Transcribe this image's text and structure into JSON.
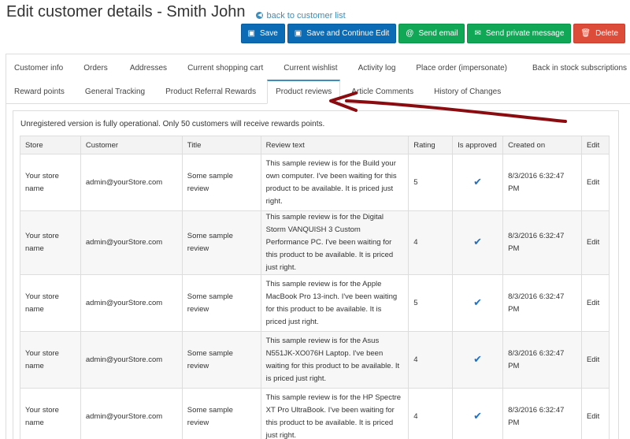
{
  "header": {
    "title": "Edit customer details - Smith John",
    "back_label": "back to customer list"
  },
  "actions": {
    "save": "Save",
    "save_continue": "Save and Continue Edit",
    "send_email": "Send email",
    "send_private": "Send private message",
    "delete": "Delete"
  },
  "tabs": {
    "row1": [
      "Customer info",
      "Orders",
      "Addresses",
      "Current shopping cart",
      "Current wishlist",
      "Activity log",
      "Place order (impersonate)",
      "Back in stock subscriptions"
    ],
    "row2": [
      "Reward points",
      "General Tracking",
      "Product Referral Rewards",
      "Product reviews",
      "Article Comments",
      "History of Changes"
    ],
    "active": "Product reviews"
  },
  "notice": "Unregistered version is fully operational. Only 50 customers will receive rewards points.",
  "table": {
    "headers": [
      "Store",
      "Customer",
      "Title",
      "Review text",
      "Rating",
      "Is approved",
      "Created on",
      "Edit"
    ],
    "rows": [
      {
        "store": "Your store name",
        "customer": "admin@yourStore.com",
        "title": "Some sample review",
        "text": "This sample review is for the Build your own computer. I've been waiting for this product to be available. It is priced just right.",
        "rating": "5",
        "created": "8/3/2016 6:32:47 PM",
        "edit": "Edit"
      },
      {
        "store": "Your store name",
        "customer": "admin@yourStore.com",
        "title": "Some sample review",
        "text": "This sample review is for the Digital Storm VANQUISH 3 Custom Performance PC. I've been waiting for this product to be available. It is priced just right.",
        "rating": "4",
        "created": "8/3/2016 6:32:47 PM",
        "edit": "Edit"
      },
      {
        "store": "Your store name",
        "customer": "admin@yourStore.com",
        "title": "Some sample review",
        "text": "This sample review is for the Apple MacBook Pro 13-inch. I've been waiting for this product to be available. It is priced just right.",
        "rating": "5",
        "created": "8/3/2016 6:32:47 PM",
        "edit": "Edit"
      },
      {
        "store": "Your store name",
        "customer": "admin@yourStore.com",
        "title": "Some sample review",
        "text": "This sample review is for the Asus N551JK-XO076H Laptop. I've been waiting for this product to be available. It is priced just right.",
        "rating": "4",
        "created": "8/3/2016 6:32:47 PM",
        "edit": "Edit"
      },
      {
        "store": "Your store name",
        "customer": "admin@yourStore.com",
        "title": "Some sample review",
        "text": "This sample review is for the HP Spectre XT Pro UltraBook. I've been waiting for this product to be available. It is priced just right.",
        "rating": "4",
        "created": "8/3/2016 6:32:47 PM",
        "edit": "Edit"
      }
    ]
  },
  "colors": {
    "primary": "#0c6bb5",
    "success": "#10a857",
    "danger": "#dd4b39",
    "link": "#3c8dbc",
    "annotation_arrow": "#8b0c10"
  },
  "icons": {
    "save": "floppy-icon",
    "save_continue": "floppy-icon",
    "send_email": "at-icon",
    "send_private": "envelope-icon",
    "delete": "trash-icon",
    "back": "arrow-left-circle-icon",
    "approved": "checkmark-icon"
  }
}
